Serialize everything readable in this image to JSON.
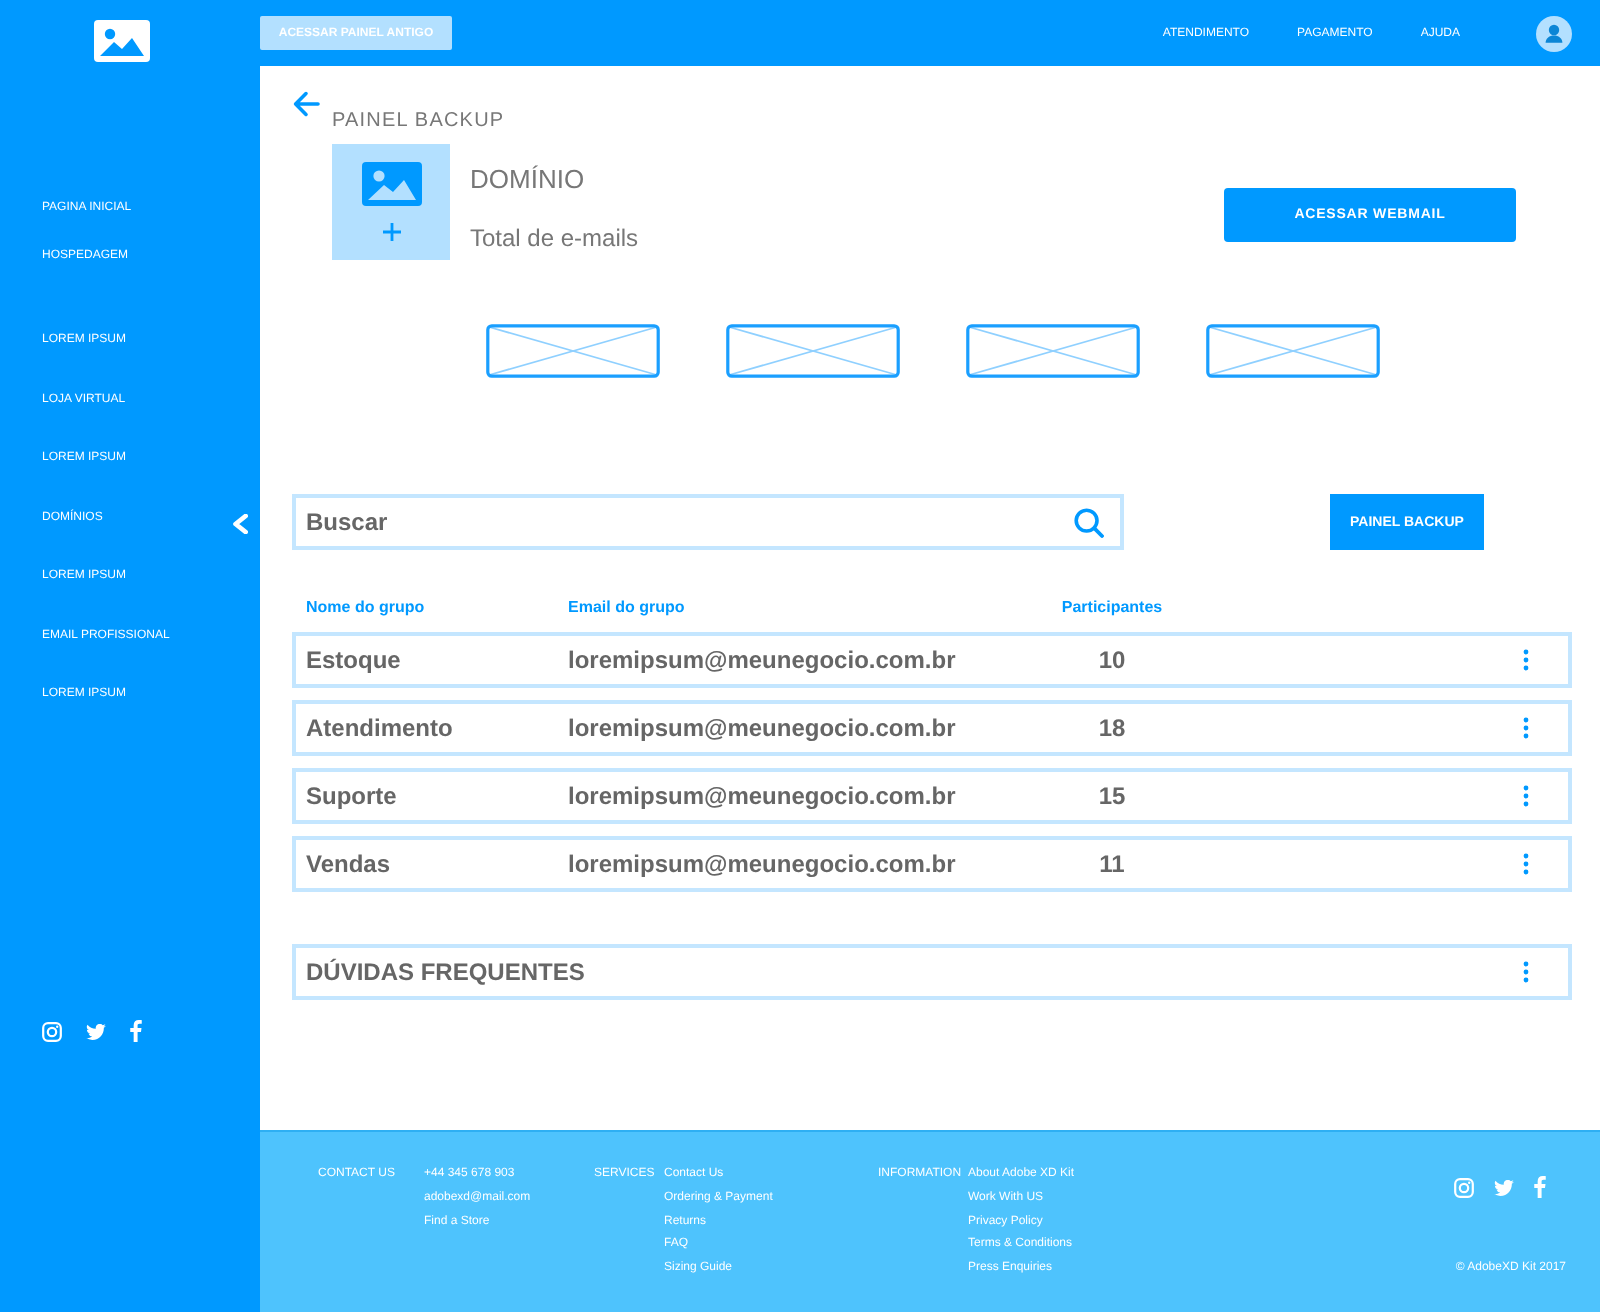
{
  "top_bar": {
    "legacy_button": "ACESSAR PAINEL ANTIGO",
    "nav": [
      "ATENDIMENTO",
      "PAGAMENTO",
      "AJUDA"
    ]
  },
  "sidebar": {
    "groups": [
      [
        "PAGINA INICIAL",
        "HOSPEDAGEM"
      ],
      [
        "LOREM IPSUM",
        "LOJA VIRTUAL",
        "LOREM IPSUM",
        "DOMÍNIOS",
        "LOREM IPSUM",
        "EMAIL PROFISSIONAL",
        "LOREM IPSUM"
      ]
    ]
  },
  "header": {
    "section_label": "PAINEL BACKUP",
    "title": "DOMÍNIO",
    "subtitle": "Total de e-mails",
    "webmail_button": "ACESSAR WEBMAIL"
  },
  "search": {
    "placeholder": "Buscar"
  },
  "backup_button": "PAINEL BACKUP",
  "table": {
    "columns": [
      "Nome do grupo",
      "Email do grupo",
      "Participantes"
    ],
    "rows": [
      {
        "name": "Estoque",
        "email": "loremipsum@meunegocio.com.br",
        "participants": "10"
      },
      {
        "name": "Atendimento",
        "email": "loremipsum@meunegocio.com.br",
        "participants": "18"
      },
      {
        "name": "Suporte",
        "email": "loremipsum@meunegocio.com.br",
        "participants": "15"
      },
      {
        "name": "Vendas",
        "email": "loremipsum@meunegocio.com.br",
        "participants": "11"
      }
    ]
  },
  "faq": {
    "title": "DÚVIDAS FREQUENTES"
  },
  "footer": {
    "columns": [
      {
        "heading": "CONTACT US",
        "links": [
          "+44 345 678 903",
          "adobexd@mail.com",
          "Find a Store"
        ]
      },
      {
        "heading": "SERVICES",
        "links": [
          "Contact Us",
          "Ordering & Payment",
          "Returns",
          "FAQ",
          "Sizing Guide"
        ]
      },
      {
        "heading": "INFORMATION",
        "links": [
          "About Adobe XD Kit",
          "Work With US",
          "Privacy Policy",
          "Terms & Conditions",
          "Press Enquiries"
        ]
      }
    ],
    "copyright": "© AdobeXD Kit 2017"
  }
}
